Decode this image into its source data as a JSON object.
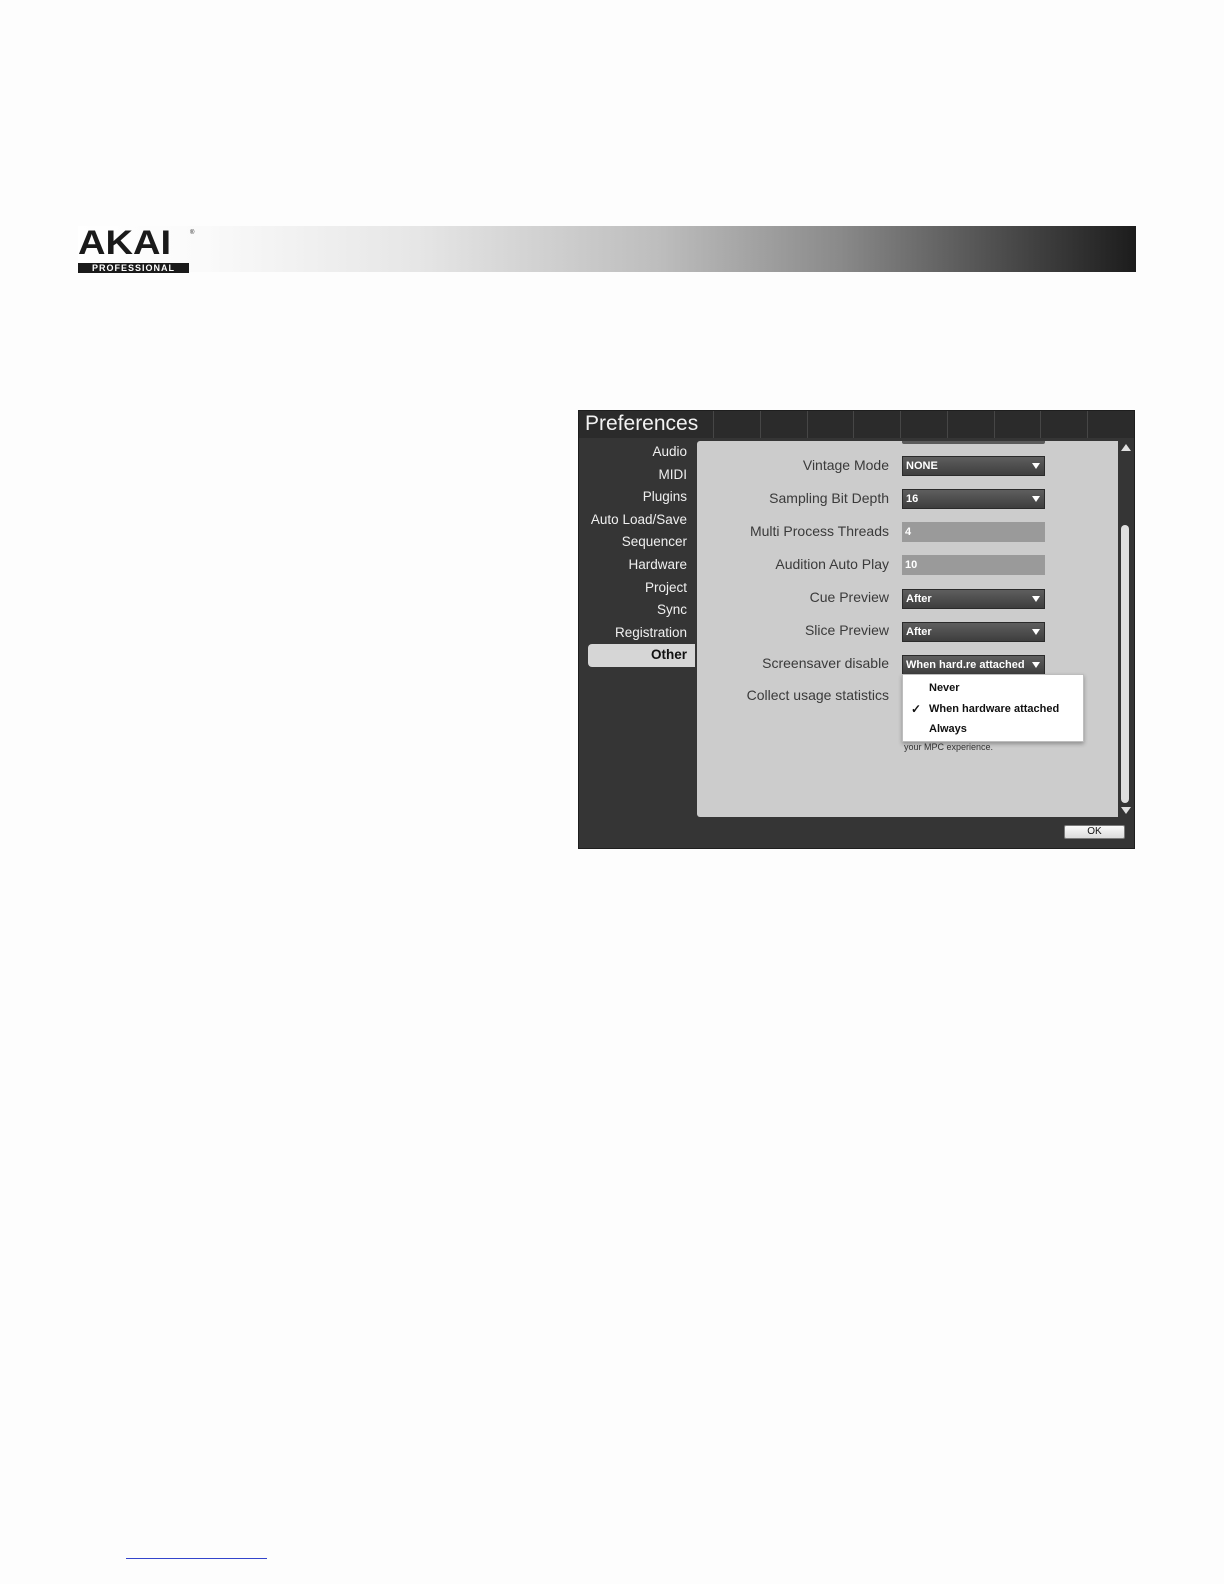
{
  "page": {
    "logo": {
      "word": "AKAI",
      "reg": "®",
      "sub": "PROFESSIONAL"
    }
  },
  "prefs": {
    "title": "Preferences",
    "categories": [
      "Audio",
      "MIDI",
      "Plugins",
      "Auto Load/Save",
      "Sequencer",
      "Hardware",
      "Project",
      "Sync",
      "Registration",
      "Other"
    ],
    "active_category": "Other",
    "rows": {
      "vintage_mode": {
        "label": "Vintage Mode",
        "value": "NONE"
      },
      "sampling_bit_depth": {
        "label": "Sampling Bit Depth",
        "value": "16"
      },
      "multi_process_threads": {
        "label": "Multi Process Threads",
        "value": "4"
      },
      "audition_auto_play": {
        "label": "Audition Auto Play",
        "value": "10"
      },
      "cue_preview": {
        "label": "Cue Preview",
        "value": "After"
      },
      "slice_preview": {
        "label": "Slice Preview",
        "value": "After"
      },
      "screensaver_disable": {
        "label": "Screensaver disable",
        "value": "When hard.re attached"
      },
      "collect_usage_statistics": {
        "label": "Collect usage statistics"
      }
    },
    "note_text": "your MPC experience.",
    "menu": {
      "check": "✓",
      "items": [
        "Never",
        "When hardware attached",
        "Always"
      ],
      "selected": "When hardware attached"
    },
    "ok_label": "OK"
  }
}
